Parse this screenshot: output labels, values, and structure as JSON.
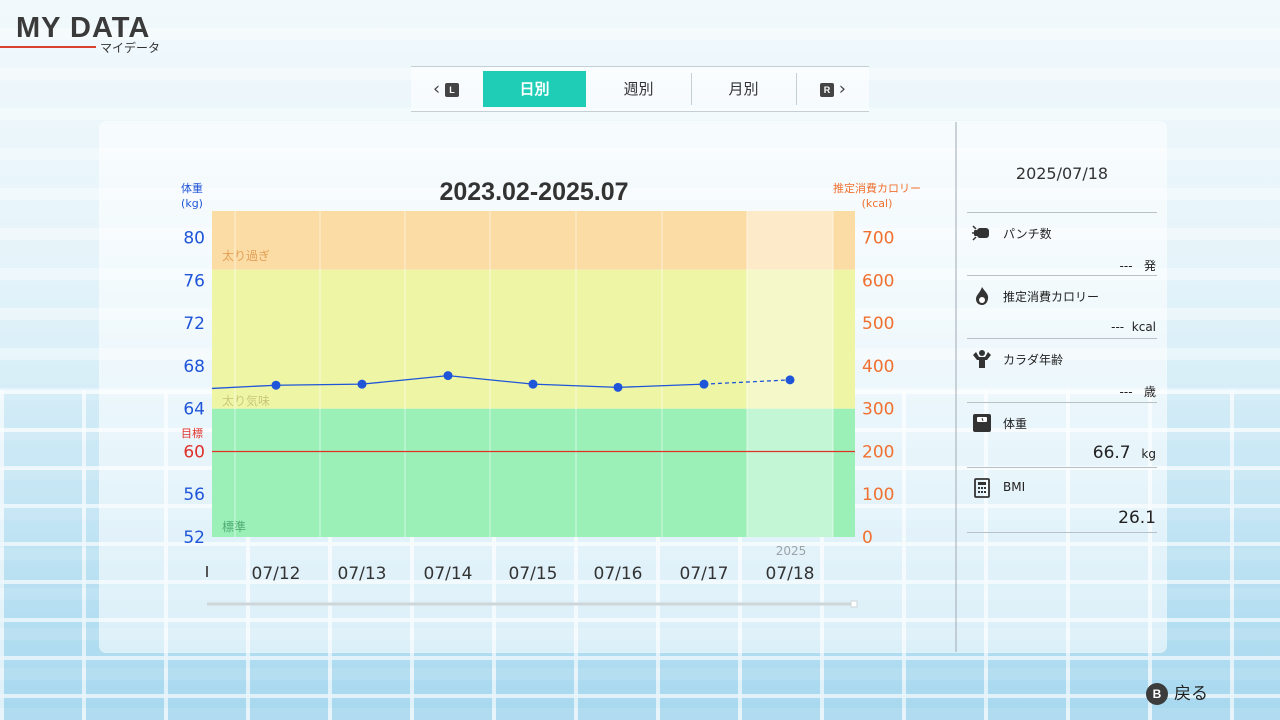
{
  "header": {
    "title": "MY DATA",
    "subtitle": "マイデータ"
  },
  "tabs": {
    "prev_button": "L",
    "next_button": "R",
    "items": [
      {
        "label": "日別",
        "active": true
      },
      {
        "label": "週別",
        "active": false
      },
      {
        "label": "月別",
        "active": false
      }
    ]
  },
  "chart_data": {
    "type": "line",
    "title": "2023.02-2025.07",
    "left_axis_label": [
      "体重",
      "(kg)"
    ],
    "right_axis_label": [
      "推定消費カロリー",
      "(kcal)"
    ],
    "left_ticks": [
      52,
      56,
      60,
      64,
      68,
      72,
      76,
      80
    ],
    "right_ticks": [
      0,
      100,
      200,
      300,
      400,
      500,
      600,
      700
    ],
    "ylim_left": [
      52,
      82.5
    ],
    "ylim_right": [
      0,
      762
    ],
    "target_label": "目標",
    "target_value": 60,
    "zones": [
      {
        "label": "太り過ぎ",
        "from": 77,
        "to": 82.5,
        "color": "#fbdca4"
      },
      {
        "label": "太り気味",
        "from": 64,
        "to": 77,
        "color": "#eef6a6"
      },
      {
        "label": "標準",
        "from": 52,
        "to": 64,
        "color": "#9bf0b8"
      }
    ],
    "categories": [
      "07/12",
      "07/13",
      "07/14",
      "07/15",
      "07/16",
      "07/17",
      "07/18"
    ],
    "year_label": "2025",
    "series": [
      {
        "values": [
          66.2,
          66.3,
          67.1,
          66.3,
          66.0,
          66.3,
          66.7
        ]
      }
    ],
    "left_edge_value": 65.9
  },
  "info": {
    "date": "2025/07/18",
    "rows": [
      {
        "label": "パンチ数",
        "value": "---",
        "unit": "発",
        "icon": "punch-icon"
      },
      {
        "label": "推定消費カロリー",
        "value": "---",
        "unit": "kcal",
        "icon": "flame-icon"
      },
      {
        "label": "カラダ年齢",
        "value": "---",
        "unit": "歳",
        "icon": "muscle-icon"
      },
      {
        "label": "体重",
        "value": "66.7",
        "unit": "kg",
        "icon": "scale-icon"
      },
      {
        "label": "BMI",
        "value": "26.1",
        "unit": "",
        "icon": "calculator-icon"
      }
    ]
  },
  "footer": {
    "back_button": "B",
    "back_label": "戻る"
  },
  "colors": {
    "accent": "#1fcdb7",
    "weight": "#1f55d8",
    "calorie": "#f07030",
    "target": "#e0302a"
  }
}
